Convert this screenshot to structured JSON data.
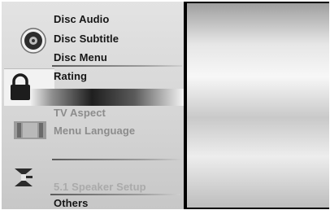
{
  "menu": {
    "items": [
      {
        "label": "Disc Audio"
      },
      {
        "label": "Disc Subtitle"
      },
      {
        "label": "Disc Menu"
      },
      {
        "label": "Rating"
      },
      {
        "label": "TV Aspect"
      },
      {
        "label": "Menu Language"
      },
      {
        "label": "5.1 Speaker Setup"
      },
      {
        "label": "Others"
      }
    ],
    "selected": "Rating",
    "icons": [
      "disc-icon",
      "lock-icon",
      "tv-icon",
      "speaker-icon"
    ]
  },
  "colors": {
    "menu_background": "#d8d8d8",
    "label_active": "#161616",
    "label_inactive": "#8c8c8c"
  }
}
